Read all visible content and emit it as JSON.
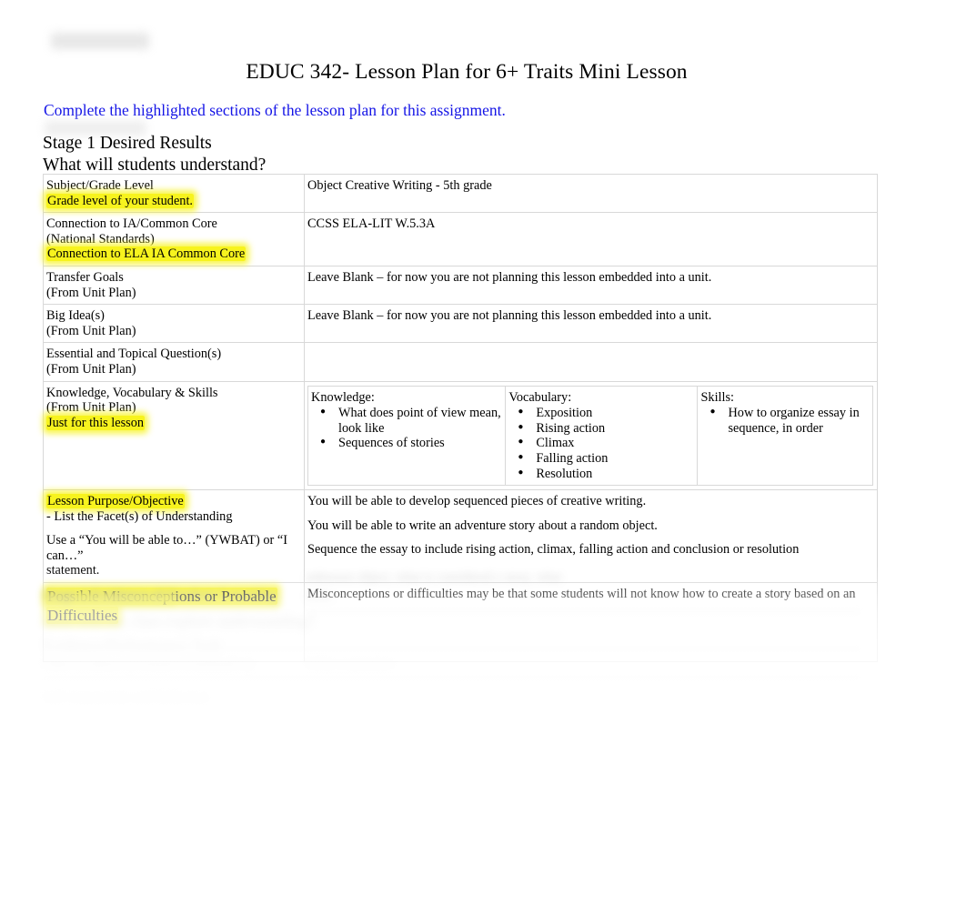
{
  "document": {
    "title": "EDUC 342- Lesson Plan for 6+ Traits Mini Lesson",
    "instruction": "Complete the highlighted sections of the lesson plan for this assignment.",
    "stage_heading_line1": "Stage 1 Desired Results",
    "stage_heading_line2": "What will students understand?"
  },
  "table": {
    "rows": [
      {
        "label_lines": [
          "Subject/Grade Level"
        ],
        "label_highlight": "Grade level of your student.",
        "value": "Object Creative Writing - 5th grade"
      },
      {
        "label_lines": [
          "Connection to IA/Common Core",
          "(National Standards)"
        ],
        "label_highlight": "Connection to ELA IA Common Core",
        "value": "CCSS ELA-LIT W.5.3A"
      },
      {
        "label_lines": [
          "Transfer Goals",
          "(From Unit Plan)"
        ],
        "label_highlight": "",
        "value": "Leave Blank – for now you are not planning this lesson embedded into a unit."
      },
      {
        "label_lines": [
          "Big Idea(s)",
          "(From Unit Plan)"
        ],
        "label_highlight": "",
        "value": "Leave Blank – for now you are not planning this lesson embedded into a unit."
      },
      {
        "label_lines": [
          "Essential and Topical Question(s)",
          "(From Unit Plan)"
        ],
        "label_highlight": "",
        "value": ""
      }
    ],
    "kvs_row": {
      "label_lines": [
        "Knowledge, Vocabulary & Skills",
        "(From Unit Plan)"
      ],
      "label_highlight": "Just for this lesson",
      "knowledge": {
        "heading": "Knowledge:",
        "items": [
          "What does point of view mean, look like",
          "Sequences of stories"
        ]
      },
      "vocabulary": {
        "heading": "Vocabulary:",
        "items": [
          "Exposition",
          "Rising action",
          "Climax",
          "Falling action",
          "Resolution"
        ]
      },
      "skills": {
        "heading": "Skills:",
        "items": [
          "How to organize essay in sequence, in order"
        ]
      }
    },
    "objective_row": {
      "label_highlight": "Lesson Purpose/Objective",
      "label_lines": [
        "- List the Facet(s) of Understanding",
        "",
        "Use a “You will be able to…” (YWBAT) or “I can…”",
        "statement."
      ],
      "values": [
        "You will be able to develop sequenced pieces of creative writing.",
        "You will be able to  write an adventure story about a random object.",
        "Sequence the essay to include rising action, climax, falling action and conclusion or resolution"
      ]
    },
    "misconceptions_row": {
      "label_highlight_line1": "Possible Misconceptions or Probable",
      "label_highlight_line2": "Difficulties",
      "value": "Misconceptions or difficulties may be that some students will not know how to create a story based on an"
    }
  },
  "obscured": {
    "note": "redacted",
    "ghost_a": "Stage 2 Evidence of Student Learning",
    "ghost_b": "How will my class explore understanding?",
    "ghost_c": "Evidence/Performance Task",
    "ghost_d": "Other Evidence (Formative/Summative)",
    "ghost_e": "Self-Assessment and Reflection",
    "ghost_f": "unknown object, what is considered a story, what",
    "ghost_g": "order",
    "ghost_h": "Write a narrative"
  },
  "colors": {
    "highlight": "#f7f31e",
    "link_blue": "#1414e6",
    "border": "#d8d8d8",
    "text": "#000000"
  }
}
